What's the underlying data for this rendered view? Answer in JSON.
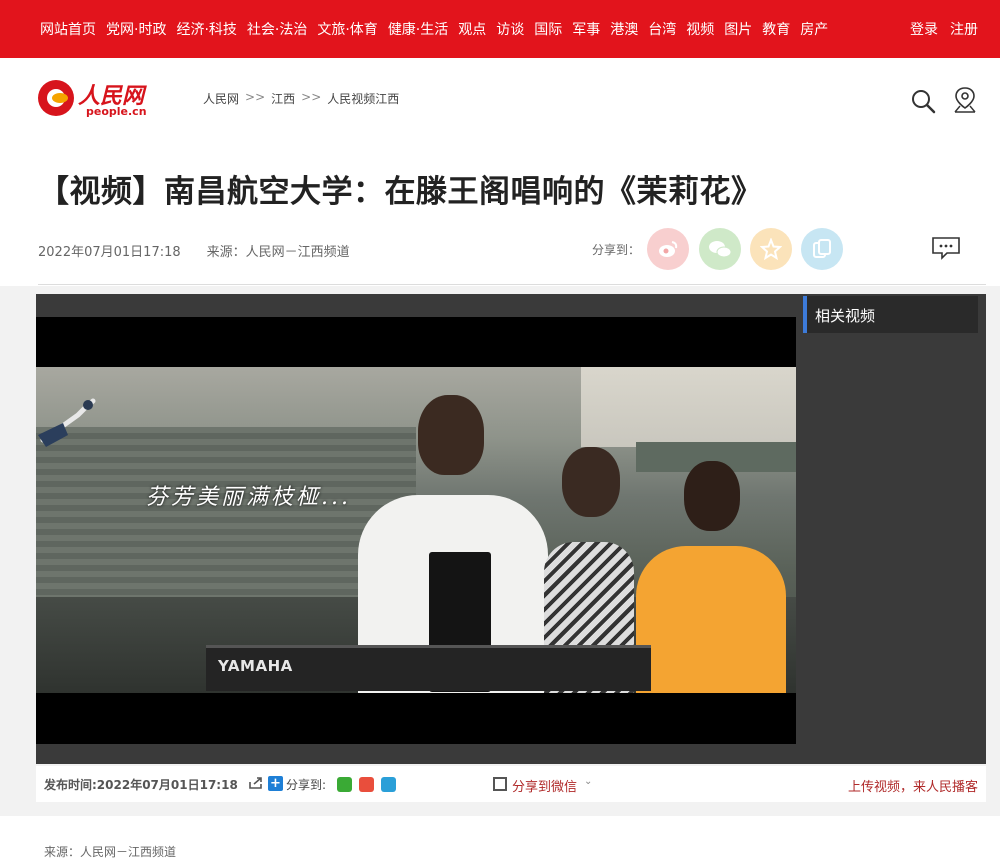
{
  "topnav": {
    "links": [
      "网站首页",
      "党网·时政",
      "经济·科技",
      "社会·法治",
      "文旅·体育",
      "健康·生活",
      "观点",
      "访谈",
      "国际",
      "军事",
      "港澳",
      "台湾",
      "视频",
      "图片",
      "教育",
      "房产"
    ],
    "login": "登录",
    "register": "注册"
  },
  "logo": {
    "cn": "人民网",
    "en": "people.cn"
  },
  "breadcrumb": [
    "人民网",
    "江西",
    "人民视频江西"
  ],
  "breadcrumb_sep": ">>",
  "article": {
    "title": "【视频】南昌航空大学：在滕王阁唱响的《茉莉花》",
    "datetime": "2022年07月01日17:18",
    "source": "来源：人民网－江西频道",
    "share_label": "分享到："
  },
  "video": {
    "subtitle": "芬芳美丽满枝桠...",
    "keyboard_brand": "YAMAHA"
  },
  "sidebar": {
    "title": "相关视频"
  },
  "player_bar": {
    "publish": "发布时间:2022年07月01日17:18",
    "share_label": "分享到:",
    "share_wechat": "分享到微信",
    "upload": "上传视频，来人民播客"
  },
  "footer_source": "来源：人民网－江西频道",
  "colors": {
    "brand_red": "#e2141c",
    "player_dark": "#3a3a3a",
    "accent_blue": "#3d7bd9"
  },
  "icons": [
    "search-icon",
    "location-pin-icon",
    "weibo-icon",
    "wechat-icon",
    "qzone-icon",
    "copy-icon",
    "comment-icon"
  ]
}
